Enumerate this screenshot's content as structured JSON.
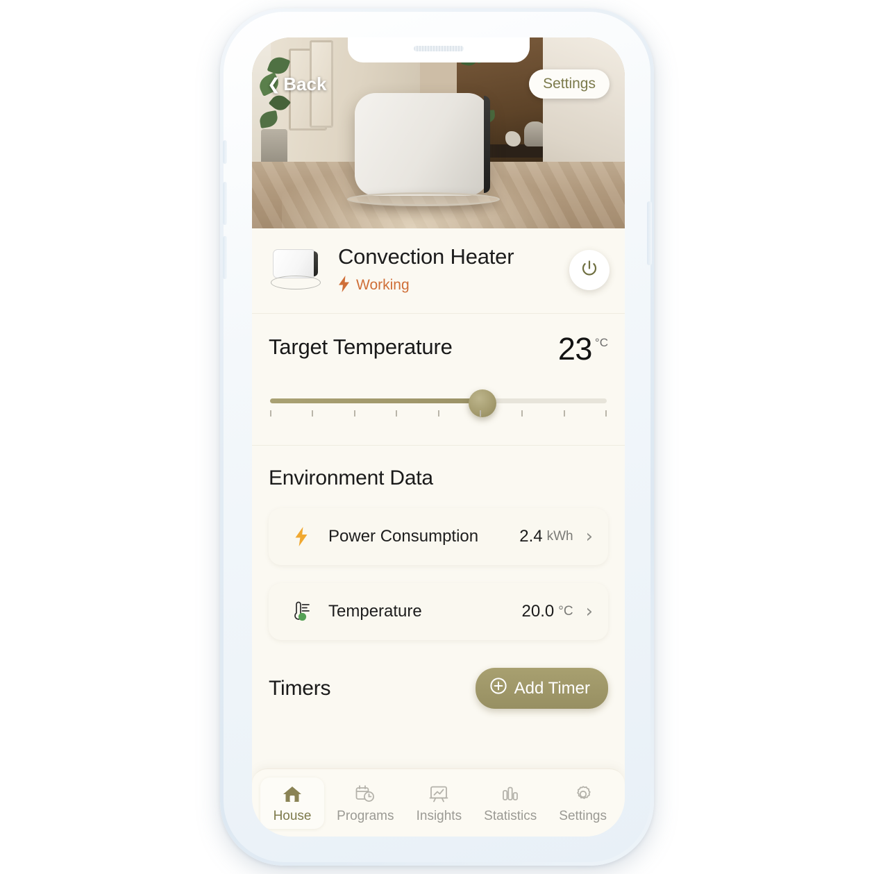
{
  "header": {
    "back_label": "Back",
    "back_icon": "chevron-left-icon",
    "settings_label": "Settings"
  },
  "device": {
    "name": "Convection Heater",
    "status": "Working",
    "status_icon": "lightning-bolt-icon",
    "status_color": "#cf6f38",
    "thumbnail_icon": "panel-heater-icon",
    "power_icon": "power-icon",
    "power_color": "#7b7a4b"
  },
  "target_temperature": {
    "label": "Target Temperature",
    "value": "23",
    "unit": "°C",
    "slider_percent": 63,
    "tick_count": 9
  },
  "environment": {
    "title": "Environment Data",
    "rows": [
      {
        "icon": "lightning-bolt-icon",
        "icon_color": "#f0a830",
        "name": "Power Consumption",
        "value": "2.4",
        "unit": "kWh",
        "chevron": "chevron-right-icon"
      },
      {
        "icon": "thermometer-icon",
        "icon_color": "#4f9a4f",
        "name": "Temperature",
        "value": "20.0",
        "unit": "°C",
        "chevron": "chevron-right-icon"
      }
    ]
  },
  "timers": {
    "title": "Timers",
    "add_label": "Add Timer",
    "add_icon": "plus-circle-icon",
    "add_color": "#a8a070"
  },
  "tabbar": {
    "items": [
      {
        "label": "House",
        "icon": "home-icon",
        "active": true
      },
      {
        "label": "Programs",
        "icon": "calendar-clock-icon",
        "active": false
      },
      {
        "label": "Insights",
        "icon": "presentation-chart-icon",
        "active": false
      },
      {
        "label": "Statistics",
        "icon": "bar-chart-icon",
        "active": false
      },
      {
        "label": "Settings",
        "icon": "gear-icon",
        "active": false
      }
    ]
  },
  "theme": {
    "accent_olive": "#9b9267",
    "screen_bg": "#fbf9f2",
    "text_primary": "#1a1a1a",
    "text_muted": "#9b9a94"
  }
}
